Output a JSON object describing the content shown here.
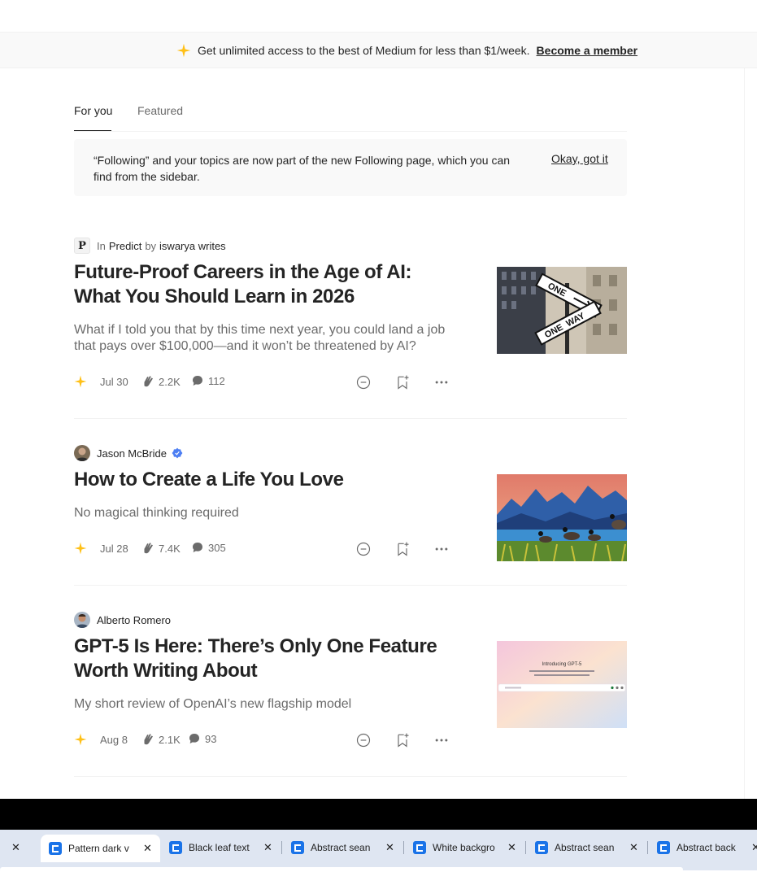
{
  "banner": {
    "text": "Get unlimited access to the best of Medium for less than $1/week.",
    "link": "Become a member"
  },
  "tabs": [
    {
      "label": "For you",
      "active": true
    },
    {
      "label": "Featured",
      "active": false
    }
  ],
  "notice": {
    "text": "“Following” and your topics are now part of the new Following page, which you can find from the sidebar.",
    "link": "Okay, got it"
  },
  "articles": [
    {
      "publication": "Predict",
      "pub_logo": "P",
      "in_label": "In",
      "by_label": "by",
      "author": "iswarya writes",
      "title": "Future-Proof Careers in the Age of AI: What You Should Learn in 2026",
      "subtitle": "What if I told you that by this time next year, you could land a job that pays over $100,000—and it won’t be threatened by AI?",
      "date": "Jul 30",
      "claps": "2.2K",
      "comments": "112",
      "thumbnail": "one-way-street-sign"
    },
    {
      "author": "Jason McBride",
      "verified": true,
      "title": "How to Create a Life You Love",
      "subtitle": "No magical thinking required",
      "date": "Jul 28",
      "claps": "7.4K",
      "comments": "305",
      "thumbnail": "painted-mountains-geese"
    },
    {
      "author": "Alberto Romero",
      "title": "GPT-5 Is Here: There’s Only One Feature Worth Writing About",
      "subtitle": "My short review of OpenAI’s new flagship model",
      "date": "Aug 8",
      "claps": "2.1K",
      "comments": "93",
      "thumbnail": "introducing-gpt-5",
      "thumb_title": "Introducing GPT-5",
      "thumb_text": "ChatGPT now has our smartest, fastest, most useful model yet, with thinking built in — so you get the best answer, every time.",
      "thumb_input": "Ask anything"
    }
  ],
  "browser_tabs": [
    {
      "label": "Pattern dark v",
      "active": true
    },
    {
      "label": "Black leaf text",
      "active": false
    },
    {
      "label": "Abstract sean",
      "active": false
    },
    {
      "label": "White backgro",
      "active": false
    },
    {
      "label": "Abstract sean",
      "active": false
    },
    {
      "label": "Abstract back",
      "active": false
    }
  ],
  "browser_tab_close": "✕",
  "colors": {
    "member_star": "#FFC017",
    "text": "#242424",
    "muted": "#6B6B6B",
    "verified": "#4C7EF3"
  },
  "icons": {
    "member": "sparkle-icon",
    "claps": "clap-icon",
    "comments": "comment-icon",
    "show_less": "minus-circle-icon",
    "save": "bookmark-plus-icon",
    "more": "more-horizontal-icon"
  }
}
